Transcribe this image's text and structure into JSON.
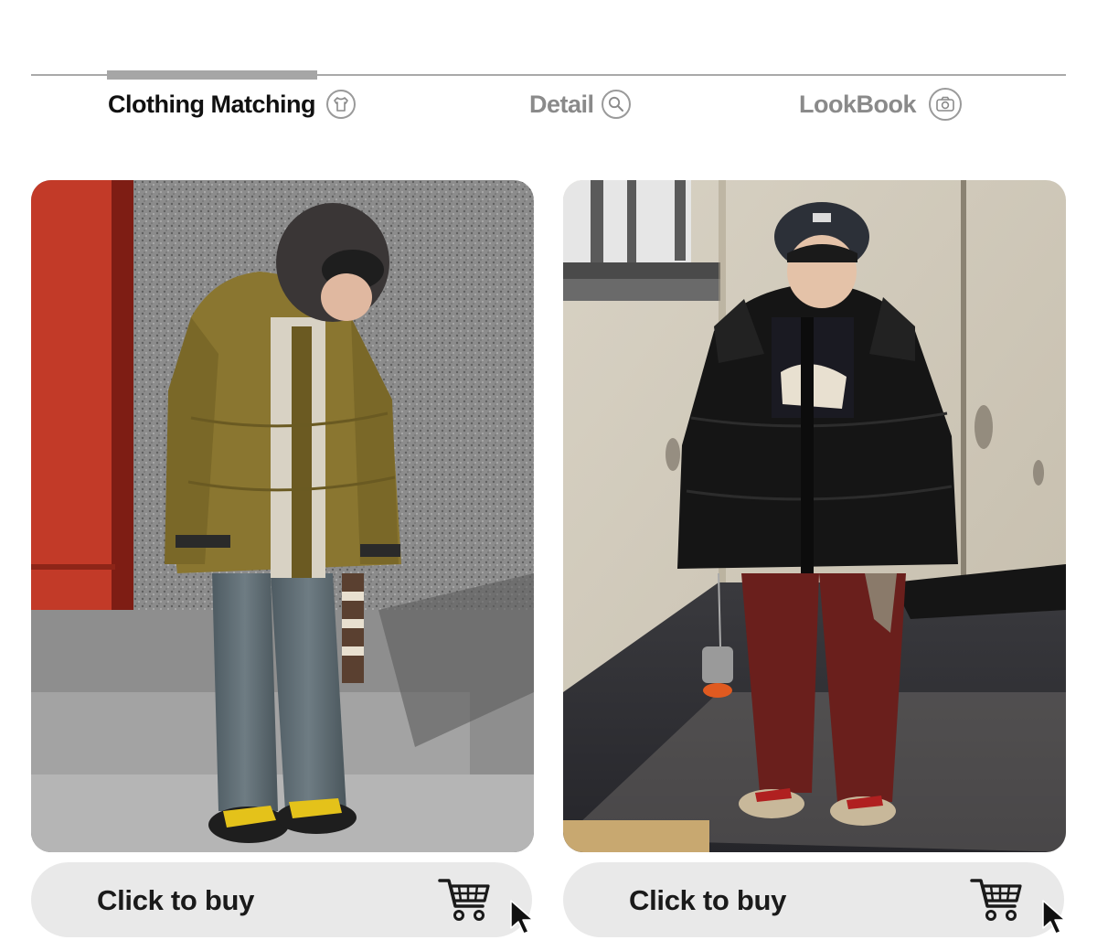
{
  "tabs": [
    {
      "label": "Clothing Matching",
      "icon": "tshirt-icon",
      "active": true
    },
    {
      "label": "Detail",
      "icon": "search-icon",
      "active": false
    },
    {
      "label": "LookBook",
      "icon": "camera-icon",
      "active": false
    }
  ],
  "products": [
    {
      "photo": "child-in-olive-puffer-jacket",
      "buy_label": "Click to buy"
    },
    {
      "photo": "child-in-black-puffer-jacket",
      "buy_label": "Click to buy"
    }
  ],
  "colors": {
    "active_tab_text": "#111111",
    "inactive_tab_text": "#8a8a8a",
    "button_bg": "#e9e9e9",
    "divider": "#a9a9a9"
  }
}
